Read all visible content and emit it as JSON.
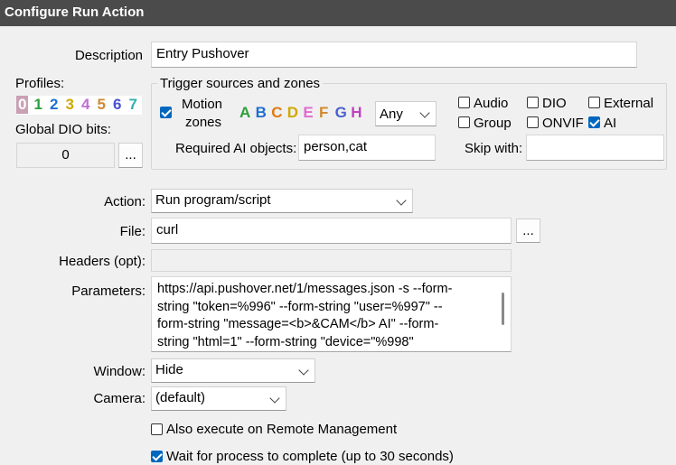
{
  "window": {
    "title": "Configure Run Action"
  },
  "description": {
    "label": "Description",
    "value": "Entry Pushover"
  },
  "profiles": {
    "label": "Profiles:",
    "items": [
      {
        "label": "0",
        "color": "#d7a0c0"
      },
      {
        "label": "1",
        "color": "#2f9e3a"
      },
      {
        "label": "2",
        "color": "#1f6fd0"
      },
      {
        "label": "3",
        "color": "#d0a800"
      },
      {
        "label": "4",
        "color": "#c06fd0"
      },
      {
        "label": "5",
        "color": "#d08a30"
      },
      {
        "label": "6",
        "color": "#4a50d0"
      },
      {
        "label": "7",
        "color": "#30b0b0"
      }
    ]
  },
  "global_dio": {
    "label": "Global DIO bits:",
    "value": "0",
    "browse_label": "..."
  },
  "trigger": {
    "group_label": "Trigger sources and zones",
    "motion_zones": {
      "label_line1": "Motion",
      "label_line2": "zones",
      "checked": true
    },
    "zones": [
      {
        "label": "A",
        "color": "#2f9e3a"
      },
      {
        "label": "B",
        "color": "#1f6fd0"
      },
      {
        "label": "C",
        "color": "#e07a10"
      },
      {
        "label": "D",
        "color": "#d0a800"
      },
      {
        "label": "E",
        "color": "#e06ad0"
      },
      {
        "label": "F",
        "color": "#d08a30"
      },
      {
        "label": "G",
        "color": "#4a60d0"
      },
      {
        "label": "H",
        "color": "#c040c0"
      }
    ],
    "zone_mode": "Any",
    "audio": {
      "label": "Audio",
      "checked": false
    },
    "group": {
      "label": "Group",
      "checked": false
    },
    "dio": {
      "label": "DIO",
      "checked": false
    },
    "onvif": {
      "label": "ONVIF",
      "checked": false
    },
    "external": {
      "label": "External",
      "checked": false
    },
    "ai": {
      "label": "AI",
      "checked": true
    },
    "required_ai": {
      "label": "Required AI objects:",
      "value": "person,cat"
    },
    "skip_with": {
      "label": "Skip with:",
      "value": ""
    }
  },
  "action": {
    "label": "Action:",
    "value": "Run program/script"
  },
  "file": {
    "label": "File:",
    "value": "curl",
    "browse_label": "..."
  },
  "headers": {
    "label": "Headers (opt):",
    "value": ""
  },
  "parameters": {
    "label": "Parameters:",
    "lines": [
      "https://api.pushover.net/1/messages.json -s --form-",
      "string \"token=%996\" --form-string \"user=%997\" --",
      "form-string \"message=<b>&CAM</b> AI\" --form-",
      "string \"html=1\" --form-string \"device=\"%998\""
    ]
  },
  "window_mode": {
    "label": "Window:",
    "value": "Hide"
  },
  "camera": {
    "label": "Camera:",
    "value": "(default)"
  },
  "remote_mgmt": {
    "label": "Also execute on Remote Management",
    "checked": false
  },
  "wait_process": {
    "label": "Wait for process to complete (up to 30 seconds)",
    "checked": true
  }
}
